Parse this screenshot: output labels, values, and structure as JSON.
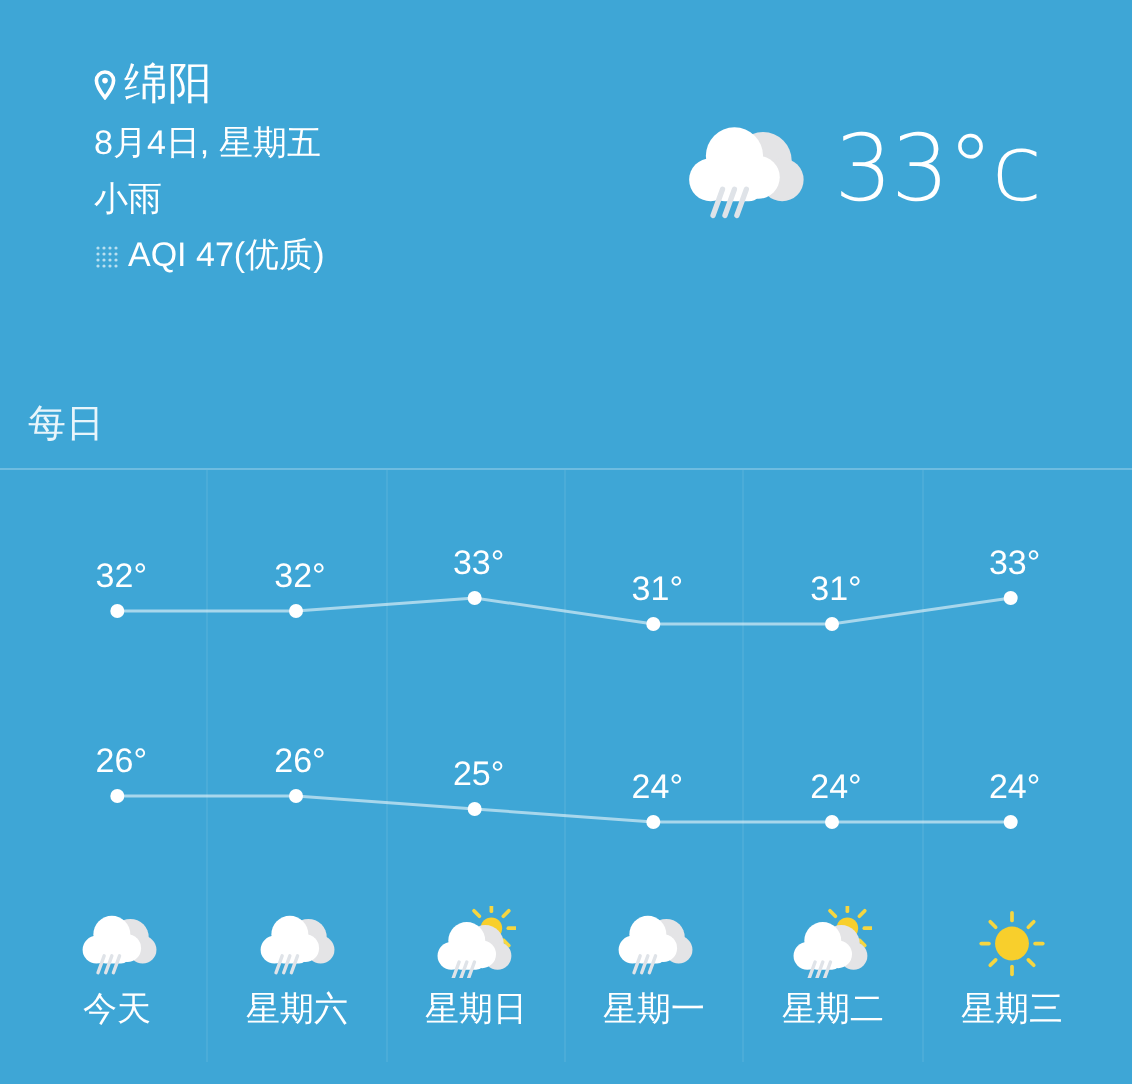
{
  "current": {
    "city": "绵阳",
    "date": "8月4日, 星期五",
    "condition": "小雨",
    "aqi": "AQI 47(优质)",
    "kind": "rain",
    "temperature": "33°c"
  },
  "daily": {
    "title": "每日",
    "days": [
      {
        "label": "今天",
        "kind": "rain",
        "high": "32°",
        "low": "26°"
      },
      {
        "label": "星期六",
        "kind": "rain",
        "high": "32°",
        "low": "26°"
      },
      {
        "label": "星期日",
        "kind": "sun-rain",
        "high": "33°",
        "low": "25°"
      },
      {
        "label": "星期一",
        "kind": "rain",
        "high": "31°",
        "low": "24°"
      },
      {
        "label": "星期二",
        "kind": "sun-rain",
        "high": "31°",
        "low": "24°"
      },
      {
        "label": "星期三",
        "kind": "sunny",
        "high": "33°",
        "low": "24°"
      }
    ]
  }
}
